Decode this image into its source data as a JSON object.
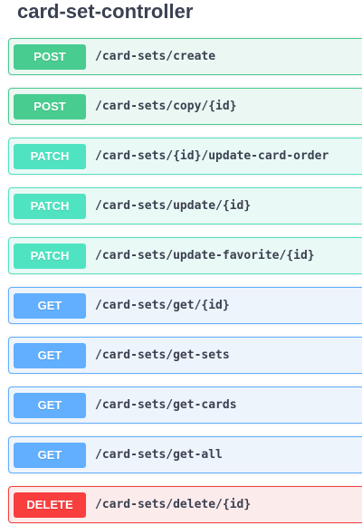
{
  "controller": {
    "title": "card-set-controller"
  },
  "colors": {
    "post": "#49cc90",
    "patch": "#50e3c2",
    "get": "#61affe",
    "delete": "#f93e3e",
    "text": "#3b4151"
  },
  "operations": [
    {
      "method": "POST",
      "path": "/card-sets/create"
    },
    {
      "method": "POST",
      "path": "/card-sets/copy/{id}"
    },
    {
      "method": "PATCH",
      "path": "/card-sets/{id}/update-card-order"
    },
    {
      "method": "PATCH",
      "path": "/card-sets/update/{id}"
    },
    {
      "method": "PATCH",
      "path": "/card-sets/update-favorite/{id}"
    },
    {
      "method": "GET",
      "path": "/card-sets/get/{id}"
    },
    {
      "method": "GET",
      "path": "/card-sets/get-sets"
    },
    {
      "method": "GET",
      "path": "/card-sets/get-cards"
    },
    {
      "method": "GET",
      "path": "/card-sets/get-all"
    },
    {
      "method": "DELETE",
      "path": "/card-sets/delete/{id}"
    }
  ]
}
